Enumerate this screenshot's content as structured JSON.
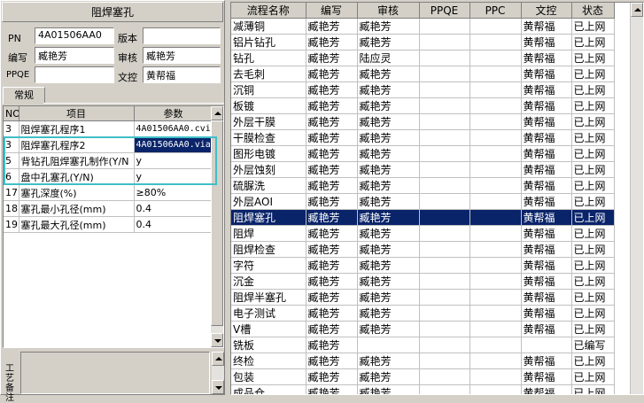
{
  "left_panel": {
    "title": "阻焊塞孔",
    "fields": {
      "pn_label": "PN",
      "pn_value": "4A01506AA0",
      "version_label": "版本",
      "version_value": "",
      "editor_label": "编写",
      "editor_value": "臧艳芳",
      "reviewer_label": "审核",
      "reviewer_value": "臧艳芳",
      "ppqe_label": "PPQE",
      "ppqe_value": "",
      "doc_control_label": "文控",
      "doc_control_value": "黄帮福"
    },
    "tab_label": "常规",
    "params_table": {
      "headers": [
        "NO",
        "项目",
        "参数"
      ],
      "rows": [
        [
          "3",
          "阻焊塞孔程序1",
          "4A01506AA0.cvi"
        ],
        [
          "3",
          "阻焊塞孔程序2",
          "4A01506AA0.via"
        ],
        [
          "5",
          "背钻孔阻焊塞孔制作(Y/N",
          "y"
        ],
        [
          "6",
          "盘中孔塞孔(Y/N)",
          "y"
        ],
        [
          "17",
          "塞孔深度(%)",
          "≥80%"
        ],
        [
          "18",
          "塞孔最小孔径(mm)",
          "0.4"
        ],
        [
          "19",
          "塞孔最大孔径(mm)",
          "0.4"
        ]
      ]
    },
    "bottom_label": "工艺备注"
  },
  "process_table": {
    "headers": [
      "流程名称",
      "编写",
      "审核",
      "PPQE",
      "PPC",
      "文控",
      "状态"
    ],
    "selected_index": 13,
    "rows": [
      [
        "减薄铜",
        "臧艳芳",
        "臧艳芳",
        "",
        "",
        "黄帮福",
        "已上网"
      ],
      [
        "铝片钻孔",
        "臧艳芳",
        "臧艳芳",
        "",
        "",
        "黄帮福",
        "已上网"
      ],
      [
        "钻孔",
        "臧艳芳",
        "陆应灵",
        "",
        "",
        "黄帮福",
        "已上网"
      ],
      [
        "去毛刺",
        "臧艳芳",
        "臧艳芳",
        "",
        "",
        "黄帮福",
        "已上网"
      ],
      [
        "沉铜",
        "臧艳芳",
        "臧艳芳",
        "",
        "",
        "黄帮福",
        "已上网"
      ],
      [
        "板镀",
        "臧艳芳",
        "臧艳芳",
        "",
        "",
        "黄帮福",
        "已上网"
      ],
      [
        "外层干膜",
        "臧艳芳",
        "臧艳芳",
        "",
        "",
        "黄帮福",
        "已上网"
      ],
      [
        "干膜检查",
        "臧艳芳",
        "臧艳芳",
        "",
        "",
        "黄帮福",
        "已上网"
      ],
      [
        "图形电镀",
        "臧艳芳",
        "臧艳芳",
        "",
        "",
        "黄帮福",
        "已上网"
      ],
      [
        "外层蚀刻",
        "臧艳芳",
        "臧艳芳",
        "",
        "",
        "黄帮福",
        "已上网"
      ],
      [
        "硫脲洗",
        "臧艳芳",
        "臧艳芳",
        "",
        "",
        "黄帮福",
        "已上网"
      ],
      [
        "外层AOI",
        "臧艳芳",
        "臧艳芳",
        "",
        "",
        "黄帮福",
        "已上网"
      ],
      [
        "阻焊塞孔",
        "臧艳芳",
        "臧艳芳",
        "",
        "",
        "黄帮福",
        "已上网"
      ],
      [
        "阻焊",
        "臧艳芳",
        "臧艳芳",
        "",
        "",
        "黄帮福",
        "已上网"
      ],
      [
        "阻焊检查",
        "臧艳芳",
        "臧艳芳",
        "",
        "",
        "黄帮福",
        "已上网"
      ],
      [
        "字符",
        "臧艳芳",
        "臧艳芳",
        "",
        "",
        "黄帮福",
        "已上网"
      ],
      [
        "沉金",
        "臧艳芳",
        "臧艳芳",
        "",
        "",
        "黄帮福",
        "已上网"
      ],
      [
        "阻焊半塞孔",
        "臧艳芳",
        "臧艳芳",
        "",
        "",
        "黄帮福",
        "已上网"
      ],
      [
        "电子测试",
        "臧艳芳",
        "臧艳芳",
        "",
        "",
        "黄帮福",
        "已上网"
      ],
      [
        "V槽",
        "臧艳芳",
        "臧艳芳",
        "",
        "",
        "黄帮福",
        "已上网"
      ],
      [
        "铣板",
        "臧艳芳",
        "",
        "",
        "",
        "",
        "已编写"
      ],
      [
        "终检",
        "臧艳芳",
        "臧艳芳",
        "",
        "",
        "黄帮福",
        "已上网"
      ],
      [
        "包装",
        "臧艳芳",
        "臧艳芳",
        "",
        "",
        "黄帮福",
        "已上网"
      ],
      [
        "成品仓",
        "臧艳芳",
        "臧艳芳",
        "",
        "",
        "黄帮福",
        "已上网"
      ]
    ]
  },
  "highlight_color": "#3fbfc7",
  "selection_color": "#0a246a"
}
